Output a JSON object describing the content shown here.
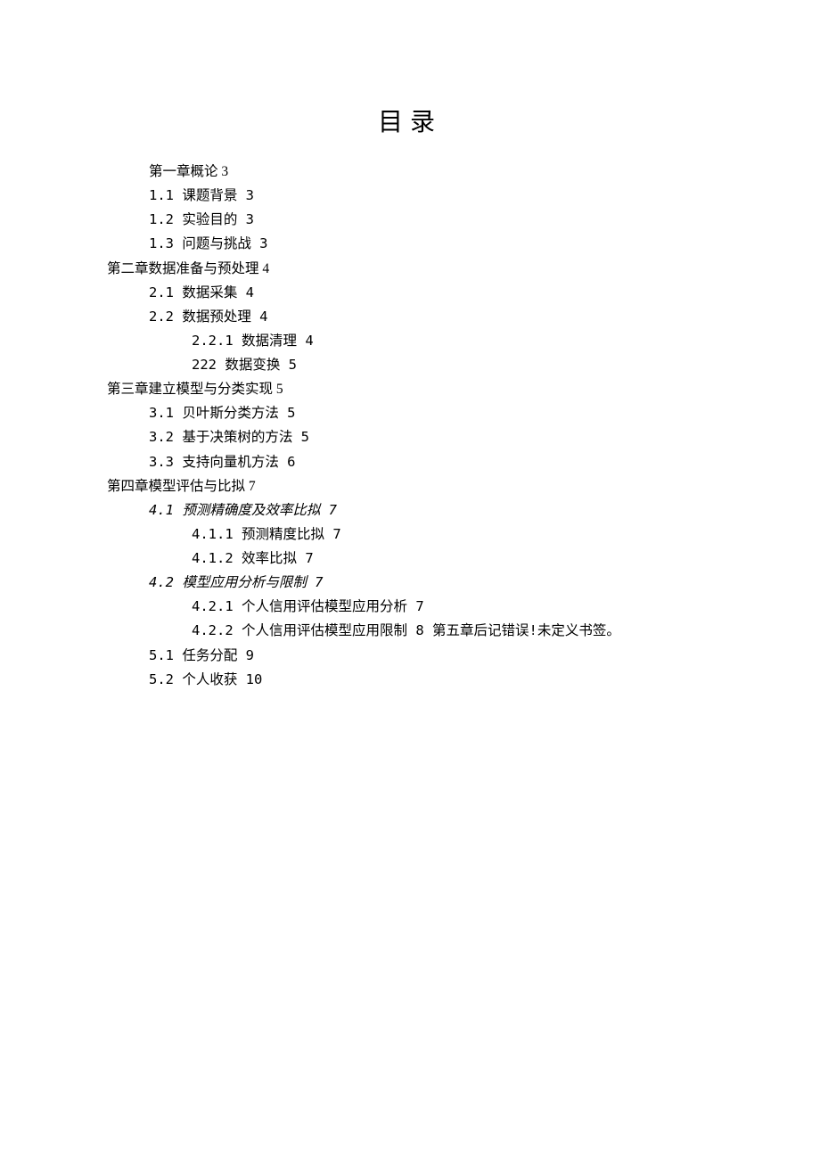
{
  "title": "目录",
  "toc": [
    {
      "indent": 1,
      "text": "第一章概论 3",
      "italic": false
    },
    {
      "indent": 1,
      "text": "1.1 课题背景 3",
      "italic": false
    },
    {
      "indent": 1,
      "text": "1.2 实验目的 3",
      "italic": false
    },
    {
      "indent": 1,
      "text": "1.3 问题与挑战 3",
      "italic": false
    },
    {
      "indent": 0,
      "text": "第二章数据准备与预处理 4",
      "italic": false
    },
    {
      "indent": 1,
      "text": "2.1 数据采集 4",
      "italic": false
    },
    {
      "indent": 1,
      "text": "2.2 数据预处理 4",
      "italic": false
    },
    {
      "indent": 2,
      "text": "2.2.1 数据清理 4",
      "italic": false
    },
    {
      "indent": 2,
      "text": "222 数据变换 5",
      "italic": false
    },
    {
      "indent": 0,
      "text": "第三章建立模型与分类实现 5",
      "italic": false
    },
    {
      "indent": 1,
      "text": "3.1 贝叶斯分类方法 5",
      "italic": false
    },
    {
      "indent": 1,
      "text": "3.2 基于决策树的方法 5",
      "italic": false
    },
    {
      "indent": 1,
      "text": "3.3 支持向量机方法 6",
      "italic": false
    },
    {
      "indent": 0,
      "text": "第四章模型评估与比拟 7",
      "italic": false
    },
    {
      "indent": 1,
      "text": "4.1 预测精确度及效率比拟 7",
      "italic": true
    },
    {
      "indent": 2,
      "text": "4.1.1 预测精度比拟 7",
      "italic": false
    },
    {
      "indent": 2,
      "text": "4.1.2 效率比拟 7",
      "italic": false
    },
    {
      "indent": 1,
      "text": "4.2 模型应用分析与限制 7",
      "italic": true
    },
    {
      "indent": 2,
      "text": "4.2.1 个人信用评估模型应用分析 7",
      "italic": false
    },
    {
      "indent": 2,
      "text": "4.2.2 个人信用评估模型应用限制 8 第五章后记错误!未定义书签。",
      "italic": false
    },
    {
      "indent": 1,
      "text": "5.1 任务分配 9",
      "italic": false
    },
    {
      "indent": 1,
      "text": "5.2 个人收获 10",
      "italic": false
    }
  ]
}
